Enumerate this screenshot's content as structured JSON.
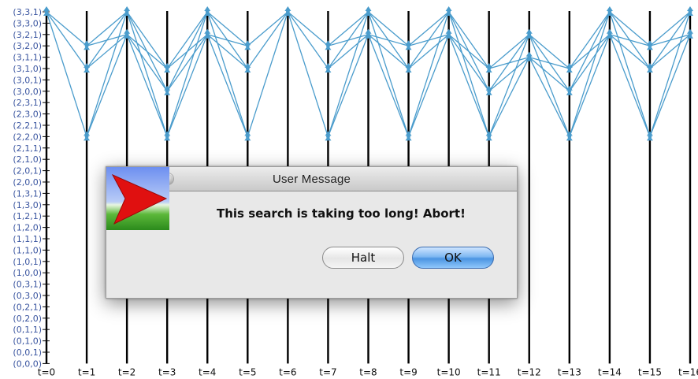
{
  "y_states": [
    "(3,3,1)",
    "(3,3,0)",
    "(3,2,1)",
    "(3,2,0)",
    "(3,1,1)",
    "(3,1,0)",
    "(3,0,1)",
    "(3,0,0)",
    "(2,3,1)",
    "(2,3,0)",
    "(2,2,1)",
    "(2,2,0)",
    "(2,1,1)",
    "(2,1,0)",
    "(2,0,1)",
    "(2,0,0)",
    "(1,3,1)",
    "(1,3,0)",
    "(1,2,1)",
    "(1,2,0)",
    "(1,1,1)",
    "(1,1,0)",
    "(1,0,1)",
    "(1,0,0)",
    "(0,3,1)",
    "(0,3,0)",
    "(0,2,1)",
    "(0,2,0)",
    "(0,1,1)",
    "(0,1,0)",
    "(0,0,1)",
    "(0,0,0)"
  ],
  "t_labels": [
    "t=0",
    "t=1",
    "t=2",
    "t=3",
    "t=4",
    "t=5",
    "t=6",
    "t=7",
    "t=8",
    "t=9",
    "t=10",
    "t=11",
    "t=12",
    "t=13",
    "t=14",
    "t=15",
    "t=16"
  ],
  "nodes": [
    [
      0
    ],
    [
      3,
      5,
      11
    ],
    [
      0,
      2
    ],
    [
      5,
      7,
      11
    ],
    [
      0,
      2
    ],
    [
      3,
      5,
      11
    ],
    [
      0
    ],
    [
      3,
      5,
      11
    ],
    [
      0,
      2
    ],
    [
      3,
      5,
      11
    ],
    [
      0,
      2
    ],
    [
      5,
      7,
      11
    ],
    [
      2,
      4
    ],
    [
      5,
      7,
      11
    ],
    [
      0,
      2
    ],
    [
      3,
      5,
      11
    ],
    [
      0,
      2
    ]
  ],
  "edge_color": "#4a9ccc",
  "dialog": {
    "title": "User Message",
    "message": "This search is taking too long! Abort!",
    "halt_label": "Halt",
    "ok_label": "OK"
  }
}
